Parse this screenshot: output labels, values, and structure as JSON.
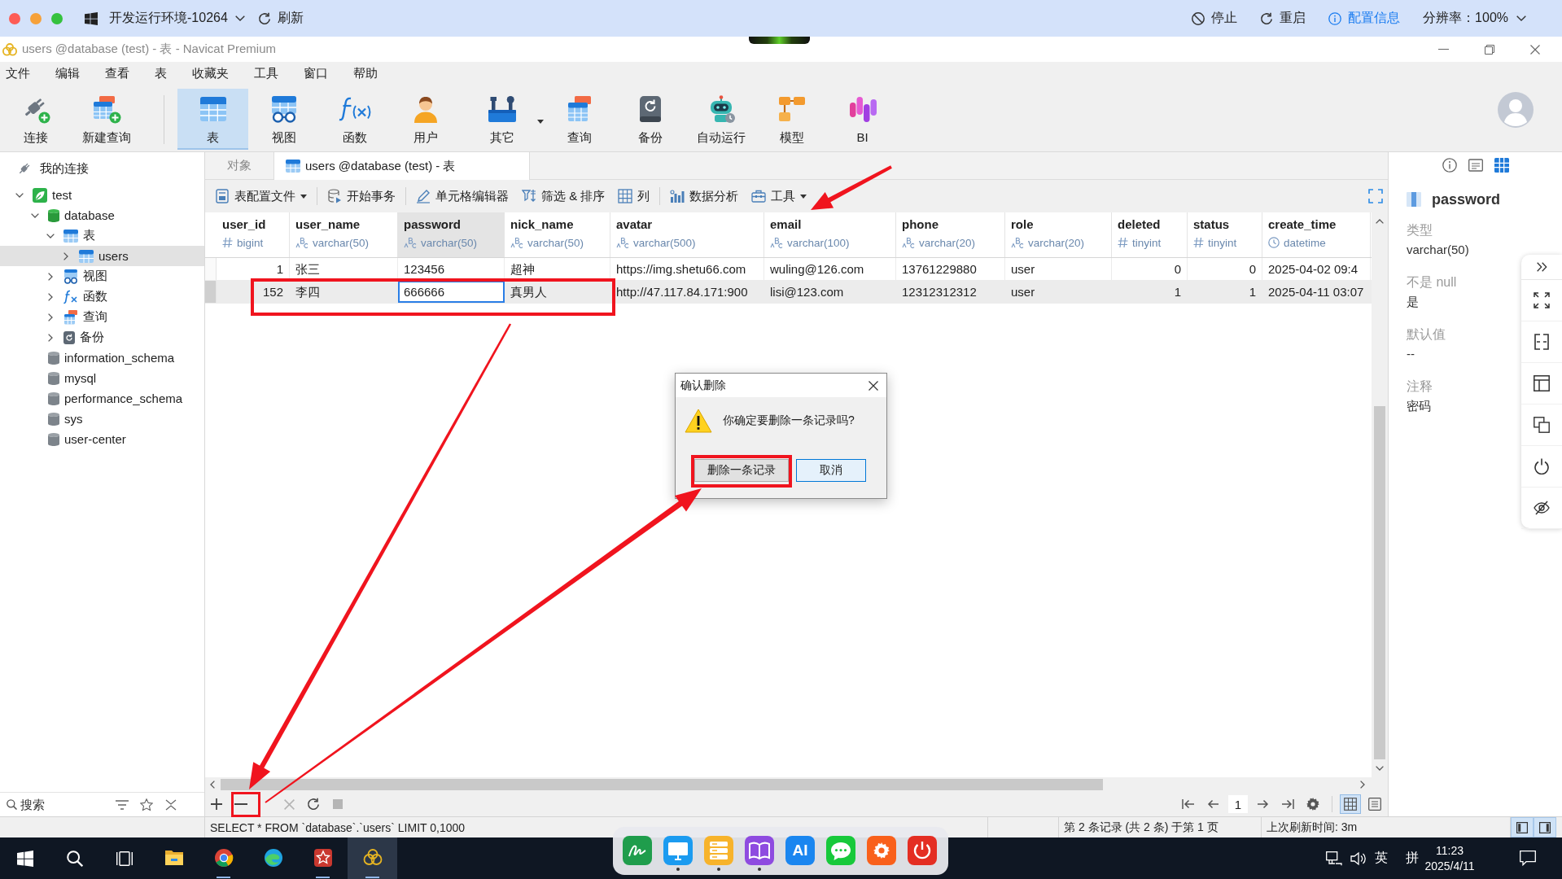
{
  "env_bar": {
    "environment": "开发运行环境-10264",
    "refresh": "刷新",
    "actions": [
      {
        "kind": "stop",
        "label": "停止"
      },
      {
        "kind": "restart",
        "label": "重启"
      },
      {
        "kind": "info",
        "label": "配置信息"
      }
    ],
    "resolution": "分辨率：100%"
  },
  "window": {
    "title": "users @database (test) - 表 - Navicat Premium"
  },
  "menu": [
    "文件",
    "编辑",
    "查看",
    "表",
    "收藏夹",
    "工具",
    "窗口",
    "帮助"
  ],
  "toolbar": [
    {
      "kind": "connect",
      "label": "连接",
      "selected": false,
      "dropdown": false
    },
    {
      "kind": "new-query",
      "label": "新建查询",
      "selected": false,
      "dropdown": false
    },
    {
      "kind": "table",
      "label": "表",
      "selected": true,
      "dropdown": false
    },
    {
      "kind": "view",
      "label": "视图",
      "selected": false,
      "dropdown": false
    },
    {
      "kind": "function",
      "label": "函数",
      "selected": false,
      "dropdown": false
    },
    {
      "kind": "user",
      "label": "用户",
      "selected": false,
      "dropdown": false
    },
    {
      "kind": "other",
      "label": "其它",
      "selected": false,
      "dropdown": true
    },
    {
      "kind": "query",
      "label": "查询",
      "selected": false,
      "dropdown": false
    },
    {
      "kind": "backup",
      "label": "备份",
      "selected": false,
      "dropdown": false
    },
    {
      "kind": "automation",
      "label": "自动运行",
      "selected": false,
      "dropdown": false
    },
    {
      "kind": "model",
      "label": "模型",
      "selected": false,
      "dropdown": false
    },
    {
      "kind": "bi",
      "label": "BI",
      "selected": false,
      "dropdown": false
    }
  ],
  "sidebar": {
    "title": "我的连接",
    "tree": [
      {
        "kind": "connection",
        "label": "test",
        "expanded": true,
        "selected": false,
        "children": [
          {
            "kind": "database",
            "label": "database",
            "expanded": true,
            "selected": false,
            "children": [
              {
                "kind": "tables",
                "label": "表",
                "expanded": true,
                "selected": false,
                "children": [
                  {
                    "kind": "table",
                    "label": "users",
                    "expanded": false,
                    "selected": true
                  }
                ]
              },
              {
                "kind": "views",
                "label": "视图",
                "expanded": false,
                "selected": false
              },
              {
                "kind": "functions",
                "label": "函数",
                "expanded": false,
                "selected": false
              },
              {
                "kind": "queries",
                "label": "查询",
                "expanded": false,
                "selected": false
              },
              {
                "kind": "backups",
                "label": "备份",
                "expanded": false,
                "selected": false
              }
            ]
          },
          {
            "kind": "database",
            "label": "information_schema",
            "expanded": false,
            "selected": false
          },
          {
            "kind": "database",
            "label": "mysql",
            "expanded": false,
            "selected": false
          },
          {
            "kind": "database",
            "label": "performance_schema",
            "expanded": false,
            "selected": false
          },
          {
            "kind": "database",
            "label": "sys",
            "expanded": false,
            "selected": false
          },
          {
            "kind": "database",
            "label": "user-center",
            "expanded": false,
            "selected": false
          }
        ]
      }
    ],
    "search_placeholder": "搜索"
  },
  "tabs": [
    {
      "kind": "objects",
      "label": "对象",
      "selected": false
    },
    {
      "kind": "table",
      "label": "users @database (test) - 表",
      "selected": true
    }
  ],
  "table_toolbar": [
    {
      "kind": "profile",
      "label": "表配置文件",
      "dropdown": true
    },
    {
      "kind": "transaction",
      "label": "开始事务",
      "dropdown": false
    },
    {
      "kind": "cell-editor",
      "label": "单元格编辑器",
      "dropdown": false
    },
    {
      "kind": "filter",
      "label": "筛选 & 排序",
      "dropdown": false
    },
    {
      "kind": "columns",
      "label": "列",
      "dropdown": false
    },
    {
      "kind": "analysis",
      "label": "数据分析",
      "dropdown": false
    },
    {
      "kind": "tools",
      "label": "工具",
      "dropdown": true
    }
  ],
  "table": {
    "columns": [
      {
        "name": "user_id",
        "type": "bigint",
        "kind": "number",
        "selected": false
      },
      {
        "name": "user_name",
        "type": "varchar(50)",
        "kind": "text",
        "selected": false
      },
      {
        "name": "password",
        "type": "varchar(50)",
        "kind": "text",
        "selected": true
      },
      {
        "name": "nick_name",
        "type": "varchar(50)",
        "kind": "text",
        "selected": false
      },
      {
        "name": "avatar",
        "type": "varchar(500)",
        "kind": "text",
        "selected": false
      },
      {
        "name": "email",
        "type": "varchar(100)",
        "kind": "text",
        "selected": false
      },
      {
        "name": "phone",
        "type": "varchar(20)",
        "kind": "text",
        "selected": false
      },
      {
        "name": "role",
        "type": "varchar(20)",
        "kind": "text",
        "selected": false
      },
      {
        "name": "deleted",
        "type": "tinyint",
        "kind": "number",
        "selected": false
      },
      {
        "name": "status",
        "type": "tinyint",
        "kind": "number",
        "selected": false
      },
      {
        "name": "create_time",
        "type": "datetime",
        "kind": "datetime",
        "selected": false
      }
    ],
    "rows": [
      {
        "selected": false,
        "cells": [
          {
            "value": "1",
            "focused": false
          },
          {
            "value": "张三",
            "focused": false
          },
          {
            "value": "123456",
            "focused": false
          },
          {
            "value": "超神",
            "focused": false
          },
          {
            "value": "https://img.shetu66.com",
            "focused": false
          },
          {
            "value": "wuling@126.com",
            "focused": false
          },
          {
            "value": "13761229880",
            "focused": false
          },
          {
            "value": "user",
            "focused": false
          },
          {
            "value": "0",
            "focused": false
          },
          {
            "value": "0",
            "focused": false
          },
          {
            "value": "2025-04-02 09:4",
            "focused": false
          }
        ]
      },
      {
        "selected": true,
        "cells": [
          {
            "value": "152",
            "focused": false
          },
          {
            "value": "李四",
            "focused": false
          },
          {
            "value": "666666",
            "focused": true
          },
          {
            "value": "真男人",
            "focused": false
          },
          {
            "value": "http://47.117.84.171:900",
            "focused": false
          },
          {
            "value": "lisi@123.com",
            "focused": false
          },
          {
            "value": "12312312312",
            "focused": false
          },
          {
            "value": "user",
            "focused": false
          },
          {
            "value": "1",
            "focused": false
          },
          {
            "value": "1",
            "focused": false
          },
          {
            "value": "2025-04-11 03:07",
            "focused": false
          }
        ]
      }
    ]
  },
  "pager": {
    "page": "1"
  },
  "view_modes": [
    {
      "kind": "grid",
      "selected": true
    },
    {
      "kind": "form",
      "selected": false
    }
  ],
  "detail_panel": {
    "tabs": [
      {
        "kind": "info",
        "selected": false
      },
      {
        "kind": "ddl",
        "selected": false
      },
      {
        "kind": "fields",
        "selected": true
      }
    ],
    "field": "password",
    "properties": [
      {
        "label": "类型",
        "value": "varchar(50)"
      },
      {
        "label": "不是 null",
        "value": "是"
      },
      {
        "label": "默认值",
        "value": "--"
      },
      {
        "label": "注释",
        "value": "密码"
      }
    ]
  },
  "status_bar": {
    "sql": "SELECT * FROM `database`.`users` LIMIT 0,1000",
    "record_info": "第 2 条记录 (共 2 条) 于第 1 页",
    "refresh_info": "上次刷新时间: 3m",
    "panes": [
      {
        "kind": "left",
        "selected": true
      },
      {
        "kind": "right",
        "selected": true
      }
    ]
  },
  "dialog": {
    "title": "确认删除",
    "message": "你确定要删除一条记录吗?",
    "buttons": [
      {
        "label": "删除一条记录",
        "focused": false
      },
      {
        "label": "取消",
        "focused": true
      }
    ]
  },
  "taskbar": {
    "apps": [
      {
        "kind": "folder",
        "running": false,
        "active": false
      },
      {
        "kind": "ring-browser",
        "running": true,
        "active": false
      },
      {
        "kind": "wave-browser",
        "running": false,
        "active": false
      },
      {
        "kind": "star-app",
        "running": true,
        "active": false
      },
      {
        "kind": "loops-app",
        "running": true,
        "active": true
      }
    ],
    "dock": [
      {
        "kind": "sign",
        "running": false
      },
      {
        "kind": "monitor",
        "running": true
      },
      {
        "kind": "server",
        "running": true
      },
      {
        "kind": "book",
        "running": true
      },
      {
        "kind": "ai",
        "text": "AI",
        "running": false
      },
      {
        "kind": "chat",
        "running": false
      },
      {
        "kind": "settings",
        "running": false
      },
      {
        "kind": "power",
        "running": false
      }
    ],
    "tray": {
      "language": "英",
      "input_method": "拼",
      "time": "11:23",
      "date": "2025/4/11"
    }
  }
}
